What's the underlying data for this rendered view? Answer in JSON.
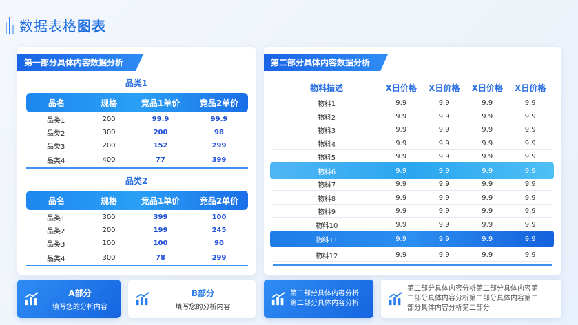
{
  "page": {
    "title_prefix": "数据表格",
    "title_bold": "图表"
  },
  "left_panel": {
    "tag": "第一部分具体内容数据分析",
    "tables": [
      {
        "title": "品类1",
        "headers": [
          "品名",
          "规格",
          "竞品1单价",
          "竞品2单价"
        ],
        "rows": [
          [
            "品类1",
            "200",
            "99.9",
            "99.9"
          ],
          [
            "品类2",
            "300",
            "200",
            "98"
          ],
          [
            "品类3",
            "200",
            "152",
            "299"
          ],
          [
            "品类4",
            "400",
            "77",
            "399"
          ]
        ]
      },
      {
        "title": "品类2",
        "headers": [
          "品名",
          "规格",
          "竞品1单价",
          "竞品2单价"
        ],
        "rows": [
          [
            "品类1",
            "300",
            "399",
            "100"
          ],
          [
            "品类2",
            "200",
            "199",
            "245"
          ],
          [
            "品类3",
            "100",
            "100",
            "90"
          ],
          [
            "品类4",
            "300",
            "78",
            "299"
          ]
        ]
      }
    ]
  },
  "right_panel": {
    "tag": "第二部分具体内容数据分析",
    "headers": [
      "物料描述",
      "X日价格",
      "X日价格",
      "X日价格",
      "X日价格"
    ],
    "rows": [
      [
        "物料1",
        "9.9",
        "9.9",
        "9.9",
        "9.9"
      ],
      [
        "物料2",
        "9.9",
        "9.9",
        "9.9",
        "9.9"
      ],
      [
        "物料3",
        "9.9",
        "9.9",
        "9.9",
        "9.9"
      ],
      [
        "物料4",
        "9.9",
        "9.9",
        "9.9",
        "9.9"
      ],
      [
        "物料5",
        "9.9",
        "9.9",
        "9.9",
        "9.9"
      ],
      [
        "物料6",
        "9.9",
        "9.9",
        "9.9",
        "9.9"
      ],
      [
        "物料7",
        "9.9",
        "9.9",
        "9.9",
        "9.9"
      ],
      [
        "物料8",
        "9.9",
        "9.9",
        "9.9",
        "9.9"
      ],
      [
        "物料9",
        "9.9",
        "9.9",
        "9.9",
        "9.9"
      ],
      [
        "物料10",
        "9.9",
        "9.9",
        "9.9",
        "9.9"
      ],
      [
        "物料11",
        "9.9",
        "9.9",
        "9.9",
        "9.9"
      ],
      [
        "物料12",
        "9.9",
        "9.9",
        "9.9",
        "9.9"
      ]
    ]
  },
  "cards": [
    {
      "title": "A部分",
      "subtitle": "填写您的分析内容",
      "icon": "bar-chart-icon"
    },
    {
      "title": "B部分",
      "subtitle": "填写您的分析内容",
      "icon": "bar-chart-icon"
    },
    {
      "body": "第二部分具体内容分析第二部分具体内容分析",
      "icon": "bar-chart-icon"
    },
    {
      "body": "第二部分具体内容分析第二部分具体内容第二部分具体内容分析第二部分具体内容第二部分具体内容分析第二部分",
      "icon": "bar-chart-icon"
    }
  ],
  "colors": {
    "accent": "#2b7ff0",
    "header_grad_start": "#1e86f0",
    "highlight_light": "#2aa5f0",
    "highlight_dark": "#1565e0"
  }
}
